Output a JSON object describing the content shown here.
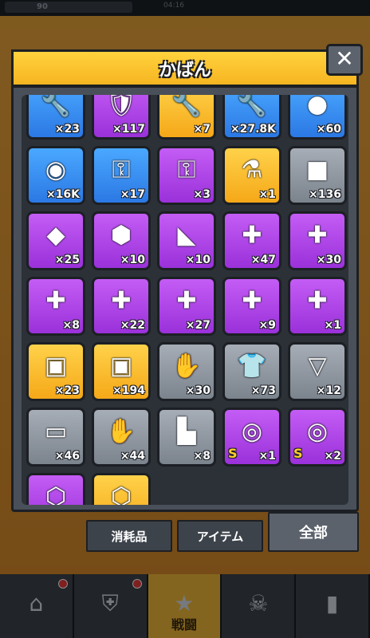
{
  "status_bar": {
    "resource_value": "90",
    "timer": "04:16"
  },
  "bag": {
    "title": "かばん",
    "close_label": "✕"
  },
  "tabs": [
    {
      "label": "消耗品",
      "active": false
    },
    {
      "label": "アイテム",
      "active": false
    },
    {
      "label": "全部",
      "active": true
    }
  ],
  "bottom_nav": {
    "battle_label": "戦闘"
  },
  "items": [
    {
      "icon": "wrench-icon",
      "qty": "×23",
      "rarity": "blue"
    },
    {
      "icon": "shield-icon",
      "qty": "×117",
      "rarity": "purple"
    },
    {
      "icon": "wrench-icon",
      "qty": "×7",
      "rarity": "orange"
    },
    {
      "icon": "wrench-icon",
      "qty": "×27.8K",
      "rarity": "blue"
    },
    {
      "icon": "coin-icon",
      "qty": "×60",
      "rarity": "blue"
    },
    {
      "icon": "lion-coin-icon",
      "qty": "×16K",
      "rarity": "blue"
    },
    {
      "icon": "silver-key-icon",
      "qty": "×17",
      "rarity": "blue"
    },
    {
      "icon": "gold-key-icon",
      "qty": "×3",
      "rarity": "purple"
    },
    {
      "icon": "potion-icon",
      "qty": "×1",
      "rarity": "orange"
    },
    {
      "icon": "cube-icon",
      "qty": "×136",
      "rarity": "gray"
    },
    {
      "icon": "gem-scroll-icon",
      "qty": "×25",
      "rarity": "purple"
    },
    {
      "icon": "crystal-icon",
      "qty": "×10",
      "rarity": "purple"
    },
    {
      "icon": "shard-icon",
      "qty": "×10",
      "rarity": "purple"
    },
    {
      "icon": "puzzle-icon",
      "qty": "×47",
      "rarity": "purple"
    },
    {
      "icon": "puzzle-icon",
      "qty": "×30",
      "rarity": "purple"
    },
    {
      "icon": "puzzle-icon",
      "qty": "×8",
      "rarity": "purple"
    },
    {
      "icon": "puzzle-icon",
      "qty": "×22",
      "rarity": "purple"
    },
    {
      "icon": "puzzle-icon",
      "qty": "×27",
      "rarity": "purple"
    },
    {
      "icon": "puzzle-icon",
      "qty": "×9",
      "rarity": "purple"
    },
    {
      "icon": "puzzle-icon",
      "qty": "×1",
      "rarity": "purple"
    },
    {
      "icon": "chest-icon",
      "qty": "×23",
      "rarity": "orange"
    },
    {
      "icon": "chest-icon",
      "qty": "×194",
      "rarity": "orange"
    },
    {
      "icon": "glove-blueprint-icon",
      "qty": "×30",
      "rarity": "gray"
    },
    {
      "icon": "shirt-blueprint-icon",
      "qty": "×73",
      "rarity": "gray"
    },
    {
      "icon": "necklace-blueprint-icon",
      "qty": "×12",
      "rarity": "gray"
    },
    {
      "icon": "belt-blueprint-icon",
      "qty": "×46",
      "rarity": "gray"
    },
    {
      "icon": "hand-blueprint-icon",
      "qty": "×44",
      "rarity": "gray"
    },
    {
      "icon": "boot-blueprint-icon",
      "qty": "×8",
      "rarity": "gray"
    },
    {
      "icon": "s-core-icon",
      "qty": "×1",
      "rarity": "purple",
      "s": "S"
    },
    {
      "icon": "s-core-icon",
      "qty": "×2",
      "rarity": "purple",
      "s": "S"
    },
    {
      "icon": "hex-core-icon",
      "qty": "",
      "rarity": "purple"
    },
    {
      "icon": "hex-core-icon",
      "qty": "",
      "rarity": "orange"
    }
  ],
  "icon_glyphs": {
    "wrench-icon": "🔧",
    "shield-icon": "🛡",
    "coin-icon": "●",
    "lion-coin-icon": "◉",
    "silver-key-icon": "⚿",
    "gold-key-icon": "⚿",
    "potion-icon": "⚗",
    "cube-icon": "■",
    "gem-scroll-icon": "◆",
    "crystal-icon": "⬢",
    "shard-icon": "◣",
    "puzzle-icon": "✚",
    "chest-icon": "▣",
    "glove-blueprint-icon": "✋",
    "shirt-blueprint-icon": "👕",
    "necklace-blueprint-icon": "▽",
    "belt-blueprint-icon": "▭",
    "hand-blueprint-icon": "✋",
    "boot-blueprint-icon": "▙",
    "s-core-icon": "◎",
    "hex-core-icon": "⬡"
  }
}
